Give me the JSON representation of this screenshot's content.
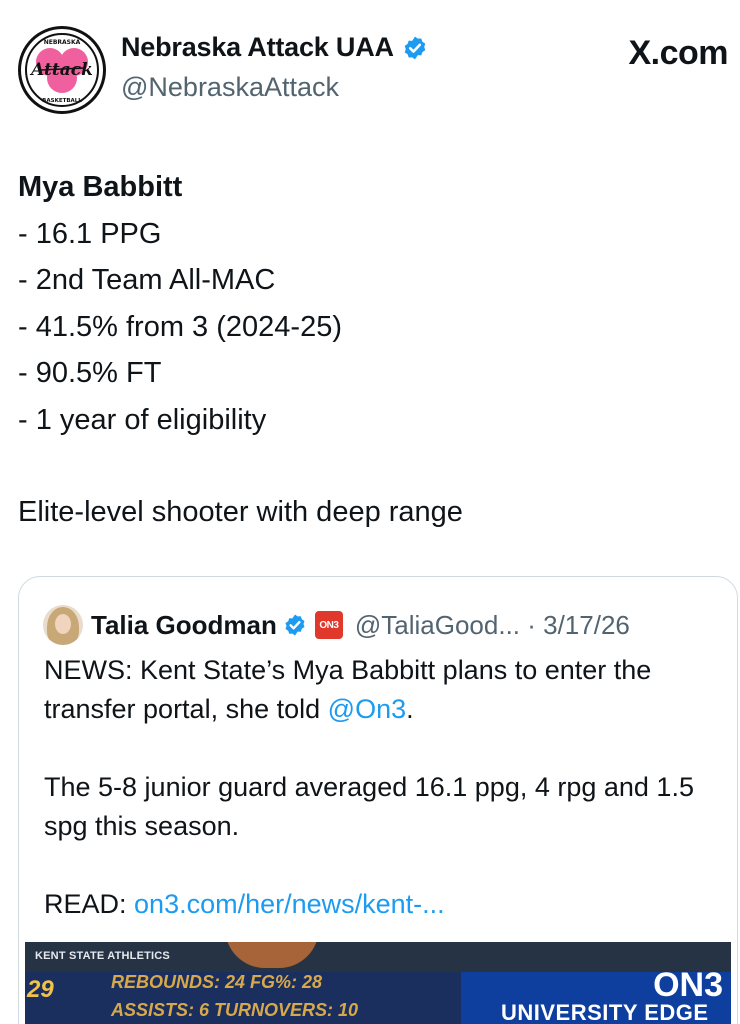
{
  "post": {
    "display_name": "Nebraska Attack UAA",
    "handle": "@NebraskaAttack",
    "site_logo": "X.com",
    "avatar_text": {
      "top": "NEBRASKA",
      "main": "Attack",
      "bottom": "BASKETBALL"
    },
    "lines": [
      "Mya Babbitt",
      "- 16.1 PPG",
      "- 2nd Team All-MAC",
      "- 41.5% from 3 (2024-25)",
      "- 90.5% FT",
      "- 1 year of eligibility"
    ],
    "closing": "Elite-level shooter with deep range"
  },
  "quote": {
    "display_name": "Talia Goodman",
    "affiliate_badge": "ON3",
    "handle_date": "@TaliaGood... · 3/17/26",
    "text1_pre": "NEWS: Kent State’s Mya Babbitt plans to enter the transfer portal, she told ",
    "text1_link": "@On3",
    "text1_post": ".",
    "text2": "The 5-8 junior guard averaged 16.1 ppg, 4 rpg and 1.5 spg this season.",
    "read_label": "READ: ",
    "read_link": "on3.com/her/news/kent-..."
  },
  "media": {
    "credit": "KENT STATE ATHLETICS",
    "number": "29",
    "stat_line1": "REBOUNDS:  24  FG%:  28",
    "stat_line2": "ASSISTS:  6  TURNOVERS:  10",
    "sponsor": "UNIVERSITY EDGE",
    "watermark": "ON3"
  },
  "colors": {
    "link": "#1d9bf0",
    "verified": "#1d9bf0",
    "secondary_text": "#536471",
    "avatar_pink": "#f0609e"
  }
}
